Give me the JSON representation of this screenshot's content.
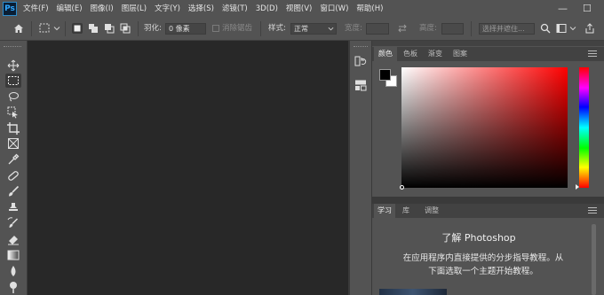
{
  "app": {
    "logo": "Ps"
  },
  "menu": [
    "文件(F)",
    "编辑(E)",
    "图像(I)",
    "图层(L)",
    "文字(Y)",
    "选择(S)",
    "滤镜(T)",
    "3D(D)",
    "视图(V)",
    "窗口(W)",
    "帮助(H)"
  ],
  "window_controls": {
    "minimize": "—",
    "maximize": "☐"
  },
  "options": {
    "feather_label": "羽化:",
    "feather_value": "0 像素",
    "antialias_label": "消除锯齿",
    "style_label": "样式:",
    "style_value": "正常",
    "width_label": "宽度:",
    "height_label": "高度:",
    "select_mask_label": "选择并遮住..."
  },
  "dock_icons": [
    "history-icon",
    "properties-icon"
  ],
  "color_panel": {
    "tabs": [
      "颜色",
      "色板",
      "渐变",
      "图案"
    ],
    "active_tab": "颜色",
    "foreground": "#000000",
    "background": "#ffffff",
    "hue": "#ff0000"
  },
  "learn_panel": {
    "tabs": [
      "学习",
      "库",
      "调整"
    ],
    "active_tab": "学习",
    "title": "了解 Photoshop",
    "desc_line1": "在应用程序内直接提供的分步指导教程。从",
    "desc_line2": "下面选取一个主题开始教程。"
  },
  "colors": {
    "chrome": "#535353",
    "canvas": "#282828",
    "tabbar": "#424242"
  }
}
